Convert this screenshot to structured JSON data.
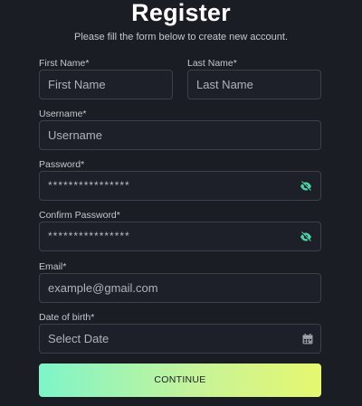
{
  "header": {
    "title": "Register",
    "subtitle": "Please fill the form below to create new account."
  },
  "form": {
    "first_name": {
      "label": "First Name*",
      "placeholder": "First Name"
    },
    "last_name": {
      "label": "Last Name*",
      "placeholder": "Last Name"
    },
    "username": {
      "label": "Username*",
      "placeholder": "Username"
    },
    "password": {
      "label": "Password*",
      "value": "****************",
      "toggle_icon": "eye-slash-icon"
    },
    "confirm_password": {
      "label": "Confirm Password*",
      "value": "****************",
      "toggle_icon": "eye-slash-icon"
    },
    "email": {
      "label": "Email*",
      "placeholder": "example@gmail.com"
    },
    "date_of_birth": {
      "label": "Date of birth*",
      "placeholder": "Select Date",
      "icon": "calendar-icon"
    },
    "continue_label": "CONTINUE"
  },
  "colors": {
    "background": "#1a1d24",
    "field_border": "#3b404b",
    "eye_icon": "#4fd1a5",
    "button_gradient_start": "#7ef5c8",
    "button_gradient_end": "#e6f76f"
  }
}
